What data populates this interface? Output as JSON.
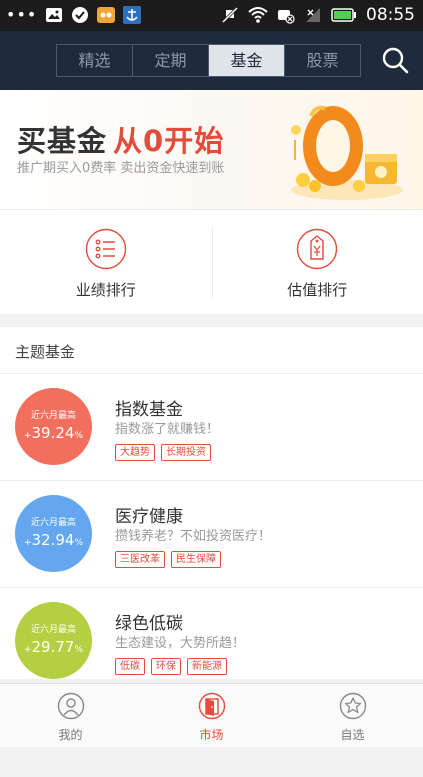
{
  "status_bar": {
    "time": "08:55",
    "icons": [
      "more-dots-icon",
      "image-icon",
      "check-badge-icon",
      "game-icon",
      "anchor-icon",
      "mute-icon",
      "wifi-icon",
      "sync-off-icon",
      "no-signal-icon",
      "battery-icon"
    ]
  },
  "nav": {
    "tabs": [
      {
        "label": "精选",
        "active": false
      },
      {
        "label": "定期",
        "active": false
      },
      {
        "label": "基金",
        "active": true
      },
      {
        "label": "股票",
        "active": false
      }
    ],
    "search_icon": "search-icon"
  },
  "banner": {
    "title_prefix": "买基金",
    "title_highlight": "从0开始",
    "subtitle": "推广期买入0费率 卖出资金快速到账",
    "art_icon": "zero-coins-illustration"
  },
  "rankings": [
    {
      "label": "业绩排行",
      "icon": "list-icon"
    },
    {
      "label": "估值排行",
      "icon": "price-tag-icon"
    }
  ],
  "theme_section": {
    "title": "主题基金",
    "funds": [
      {
        "caption": "近六月最高",
        "return_sign": "+",
        "return_value": "39.24",
        "return_unit": "%",
        "name": "指数基金",
        "desc": "指数涨了就赚钱！",
        "tags": [
          "大趋势",
          "长期投资"
        ],
        "color": "#f36f5d"
      },
      {
        "caption": "近六月最高",
        "return_sign": "+",
        "return_value": "32.94",
        "return_unit": "%",
        "name": "医疗健康",
        "desc": "攒钱养老？不如投资医疗！",
        "tags": [
          "三医改革",
          "民生保障"
        ],
        "color": "#64a7f0"
      },
      {
        "caption": "近六月最高",
        "return_sign": "+",
        "return_value": "29.77",
        "return_unit": "%",
        "name": "绿色低碳",
        "desc": "生态建设，大势所趋！",
        "tags": [
          "低碳",
          "环保",
          "新能源"
        ],
        "color": "#b5cf43"
      }
    ]
  },
  "bottom_nav": [
    {
      "label": "我的",
      "icon": "user-icon",
      "active": false
    },
    {
      "label": "市场",
      "icon": "market-door-icon",
      "active": true
    },
    {
      "label": "自选",
      "icon": "star-icon",
      "active": false
    }
  ],
  "colors": {
    "accent": "#e54b3b",
    "nav_bg": "#1f2a3c"
  }
}
